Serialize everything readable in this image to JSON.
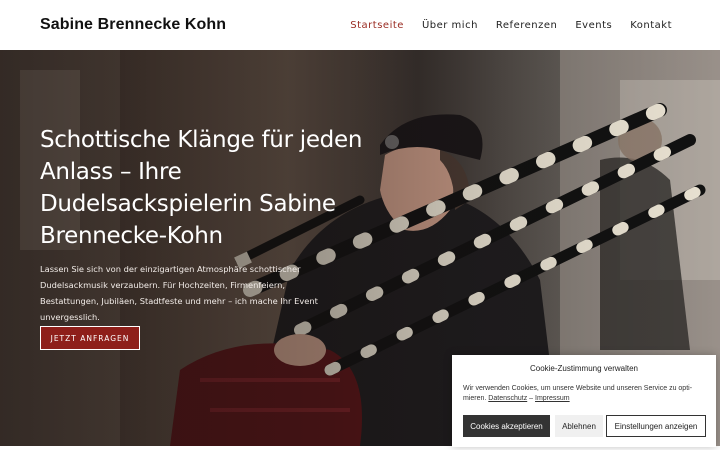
{
  "header": {
    "brand": "Sabine Brennecke Kohn",
    "nav": [
      {
        "label": "Startseite",
        "active": true
      },
      {
        "label": "Über mich",
        "active": false
      },
      {
        "label": "Referenzen",
        "active": false
      },
      {
        "label": "Events",
        "active": false
      },
      {
        "label": "Kontakt",
        "active": false
      }
    ]
  },
  "hero": {
    "title": "Schottische Klänge für jeden Anlass – Ihre Dudelsackspielerin Sabine Brennecke-Kohn",
    "text": "Lassen Sie sich von der einzigartigen Atmosphäre schottischer Dudelsackmusik verzaubern. Für Hochzeiten, Firmenfeiern, Bestattungen, Jubiläen, Stadtfeste und mehr – ich mache Ihr Event unvergesslich.",
    "cta_label": "JETZT ANFRAGEN",
    "image_subject": "bagpiper-photo"
  },
  "cookie": {
    "title": "Cookie-Zustimmung verwalten",
    "text": "Wir verwenden Cookies, um unsere Website und unseren Service zu opti­mieren.",
    "link_privacy": "Datenschutz",
    "separator": " – ",
    "link_imprint": "Impressum",
    "accept_label": "Cookies akzeptieren",
    "decline_label": "Ablehnen",
    "settings_label": "Einstellungen anzeigen"
  },
  "colors": {
    "accent": "#9a2b22",
    "cta_bg": "#8e1f1a",
    "cookie_dark": "#333333"
  }
}
